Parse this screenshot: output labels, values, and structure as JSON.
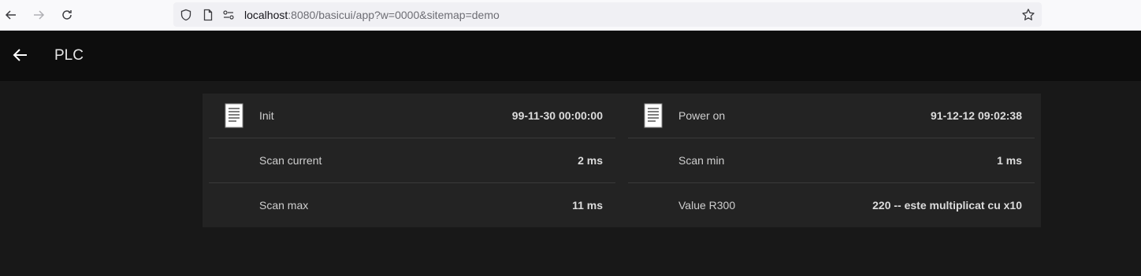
{
  "browser": {
    "url_host": "localhost",
    "url_rest": ":8080/basicui/app?w=0000&sitemap=demo"
  },
  "header": {
    "title": "PLC"
  },
  "left_column": [
    {
      "label": "Init",
      "value": "99-11-30 00:00:00",
      "icon": "document-icon"
    },
    {
      "label": "Scan current",
      "value": "2 ms",
      "icon": ""
    },
    {
      "label": "Scan max",
      "value": "11 ms",
      "icon": ""
    }
  ],
  "right_column": [
    {
      "label": "Power on",
      "value": "91-12-12 09:02:38",
      "icon": "document-icon"
    },
    {
      "label": "Scan min",
      "value": "1 ms",
      "icon": ""
    },
    {
      "label": "Value R300",
      "value": "220 -- este multiplicat cu x10",
      "icon": ""
    }
  ],
  "colors": {
    "background": "#181818",
    "header": "#0d0d0d",
    "card": "#232323"
  }
}
